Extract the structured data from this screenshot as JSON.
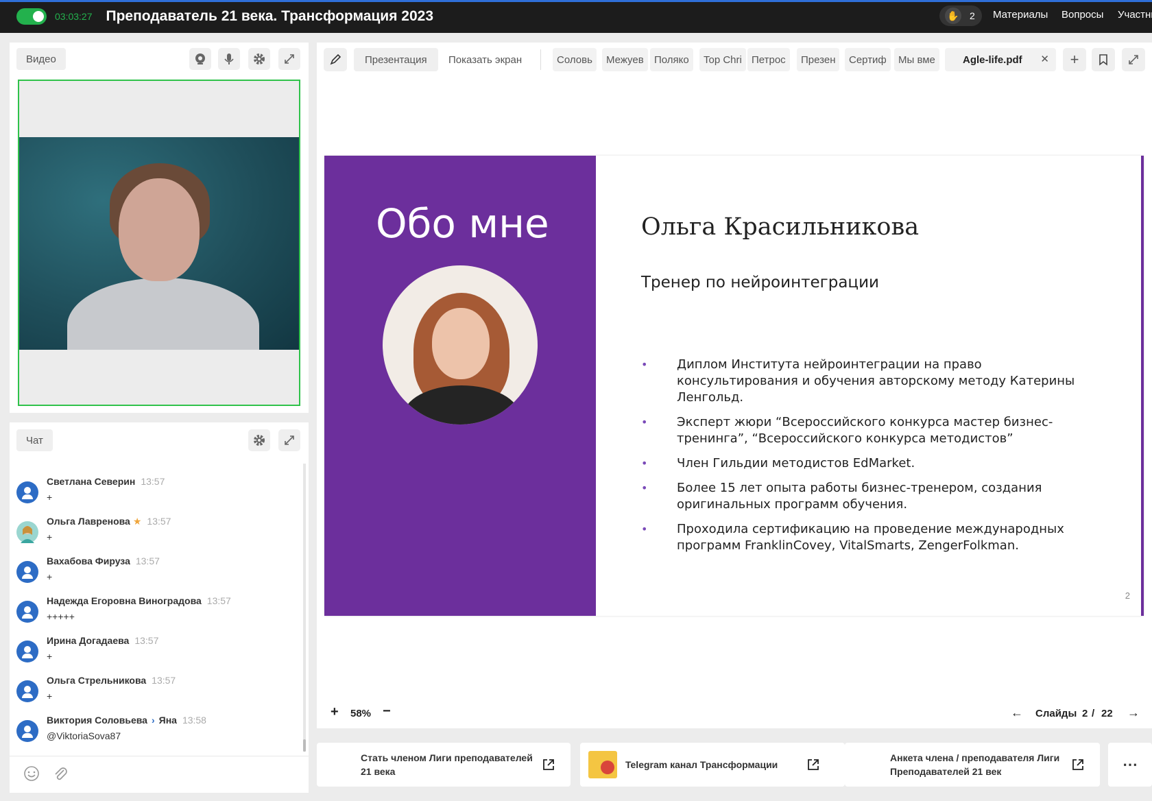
{
  "topbar": {
    "timer": "03:03:27",
    "title": "Преподаватель 21 века. Трансформация 2023",
    "hand_count": "2",
    "nav": [
      "Материалы",
      "Вопросы",
      "Участни"
    ]
  },
  "video_panel": {
    "tab_label": "Видео"
  },
  "chat_panel": {
    "tab_label": "Чат",
    "messages": [
      {
        "name": "Светлана Северин",
        "time": "13:57",
        "text": "+"
      },
      {
        "name": "Ольга Лавренова",
        "time": "13:57",
        "text": "+"
      },
      {
        "name": "Вахабова Фируза",
        "time": "13:57",
        "text": "+"
      },
      {
        "name": "Надежда Егоровна Виноградова",
        "time": "13:57",
        "text": "+++++"
      },
      {
        "name": "Ирина Догадаева",
        "time": "13:57",
        "text": "+"
      },
      {
        "name": "Ольга Стрельникова",
        "time": "13:57",
        "text": "+"
      },
      {
        "name": "Виктория Соловьева",
        "recipient": "Яна",
        "time": "13:58",
        "text": "@ViktoriaSova87"
      }
    ]
  },
  "presentation": {
    "tabs": {
      "presentation": "Презентация",
      "share_screen": "Показать экран",
      "files": [
        "Соловь",
        "Межуев",
        "Поляко",
        "Top Chri",
        "Петрос",
        "Презен",
        "Сертиф",
        "Мы вме"
      ],
      "active_file": "Agle-life.pdf"
    },
    "slide": {
      "heading": "Обо мне",
      "name": "Ольга Красильникова",
      "subtitle": "Тренер по нейроинтеграции",
      "bullets": [
        "Диплом Института нейроинтеграции на право консультирования и обучения авторскому методу Катерины Ленгольд.",
        "Эксперт жюри “Всероссийского конкурса мастер бизнес-тренинга”, “Всероссийского конкурса методистов”",
        "Член Гильдии методистов EdMarket.",
        "Более 15 лет опыта работы бизнес-тренером, создания оригинальных программ обучения.",
        "Проходила сертификацию на проведение международных программ FranklinCovey, VitalSmarts, ZengerFolkman."
      ],
      "page_number": "2"
    },
    "zoom": "58%",
    "slides_label": "Слайды",
    "current_slide": "2",
    "slide_separator": "/",
    "total_slides": "22"
  },
  "links": [
    {
      "label": "Стать членом Лиги преподавателей 21 века"
    },
    {
      "label": "Telegram канал Трансформации"
    },
    {
      "label": "Анкета члена / преподавателя Лиги Преподавателей 21 век"
    }
  ],
  "colors": {
    "accent_green": "#23b14d",
    "slide_purple": "#6c2f9c",
    "avatar_blue": "#2d6cc5"
  }
}
